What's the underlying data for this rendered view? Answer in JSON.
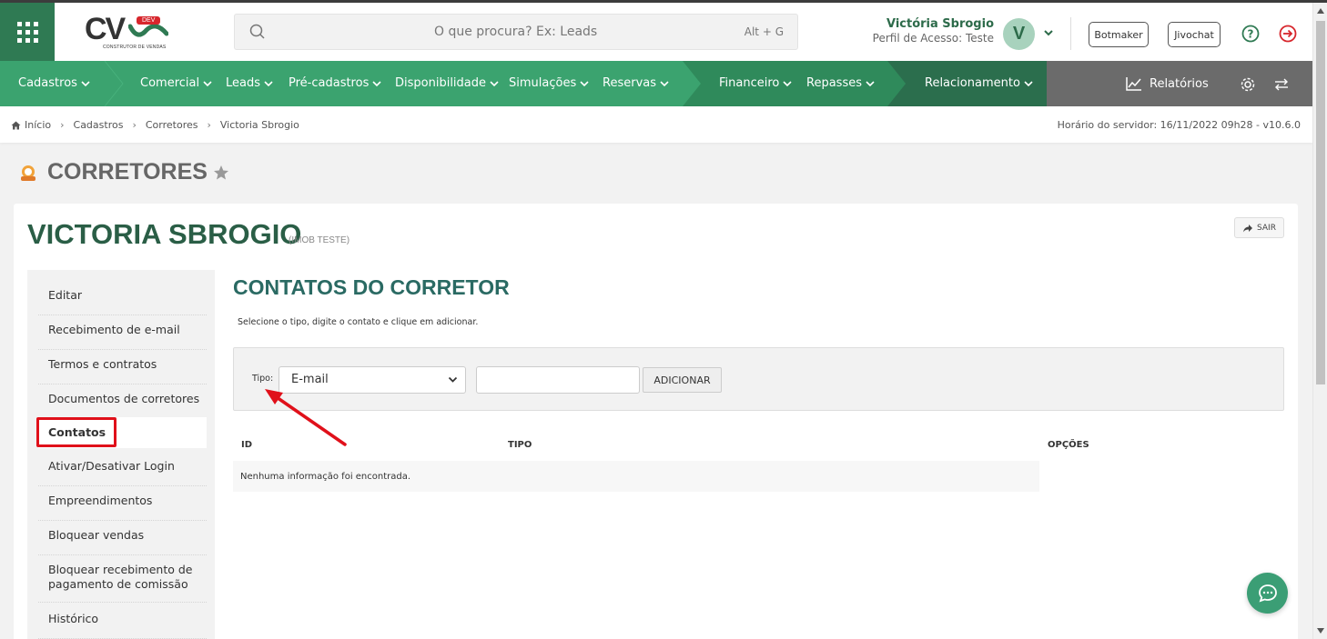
{
  "header": {
    "search_placeholder": "O que procura? Ex: Leads",
    "search_shortcut": "Alt + G",
    "user_name": "Victória Sbrogio",
    "user_role": "Perfil de Acesso: Teste",
    "avatar_initial": "V",
    "logo_badge": "DEV",
    "logo_sub": "CONSTRUTOR DE VENDAS",
    "botmaker_label": "Botmaker",
    "jivochat_label": "Jivochat"
  },
  "nav": {
    "items": [
      "Cadastros",
      "Comercial",
      "Leads",
      "Pré-cadastros",
      "Disponibilidade",
      "Simulações",
      "Reservas",
      "Financeiro",
      "Repasses",
      "Relacionamento"
    ],
    "reports_label": "Relatórios"
  },
  "breadcrumb": {
    "items": [
      "Início",
      "Cadastros",
      "Corretores",
      "Victoria Sbrogio"
    ],
    "server_time": "Horário do servidor: 16/11/2022 09h28 - v10.6.0"
  },
  "page": {
    "title": "CORRETORES",
    "person_name": "VICTORIA SBROGIO",
    "person_company": "(IMOB TESTE)",
    "exit_label": "SAIR"
  },
  "sidebar": {
    "items": [
      "Editar",
      "Recebimento de e-mail",
      "Termos e contratos",
      "Documentos de corretores",
      "Contatos",
      "Ativar/Desativar Login",
      "Empreendimentos",
      "Bloquear vendas",
      "Bloquear recebimento de pagamento de comissão",
      "Histórico"
    ],
    "active_index": 4
  },
  "section": {
    "title": "CONTATOS DO CORRETOR",
    "description": "Selecione o tipo, digite o contato e clique em adicionar.",
    "type_label": "Tipo:",
    "type_selected": "E-mail",
    "contact_value": "",
    "add_label": "ADICIONAR"
  },
  "table": {
    "columns": [
      "ID",
      "TIPO",
      "OPÇÕES"
    ],
    "empty_message": "Nenhuma informação foi encontrada."
  },
  "colors": {
    "brand_green": "#3ba36f",
    "dark_green": "#2f7a53",
    "highlight_red": "#e0101a"
  }
}
